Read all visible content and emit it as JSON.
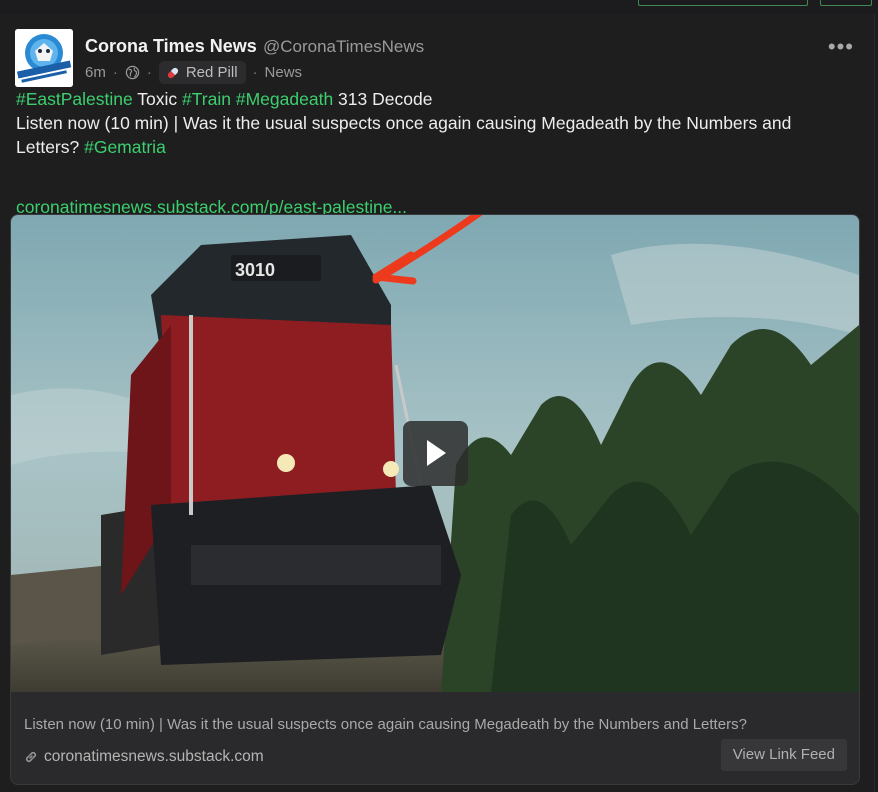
{
  "post": {
    "author_name": "Corona Times News",
    "author_handle": "@CoronaTimesNews",
    "timestamp": "6m",
    "visibility_icon": "globe-icon",
    "badge_label": "Red Pill",
    "badge_icon": "red-pill-icon",
    "category": "News",
    "more_label": "•••",
    "line1": {
      "tag1": "#EastPalestine",
      "text1": " Toxic ",
      "tag2": "#Train",
      "text2": " ",
      "tag3": "#Megadeath",
      "text3": " 313 Decode"
    },
    "line2": "Listen now (10 min) | Was it the usual suspects once again causing Megadeath by the Numbers and Letters? ",
    "line2_tag": "#Gematria",
    "link": "coronatimesnews.substack.com/p/east-palestine...",
    "avatar_text": "CORONA TIMES NEWS"
  },
  "card": {
    "thumbnail_number": "3010",
    "play_icon": "play-icon",
    "title": "Listen now (10 min) | Was it the usual suspects once again causing Megadeath by the Numbers and Letters?",
    "domain_icon": "link-icon",
    "domain": "coronatimesnews.substack.com",
    "view_feed_label": "View Link Feed"
  },
  "colors": {
    "accent_green": "#3ccf6e",
    "background": "#1e1e1f",
    "annotation_arrow": "#ee3a1c"
  }
}
